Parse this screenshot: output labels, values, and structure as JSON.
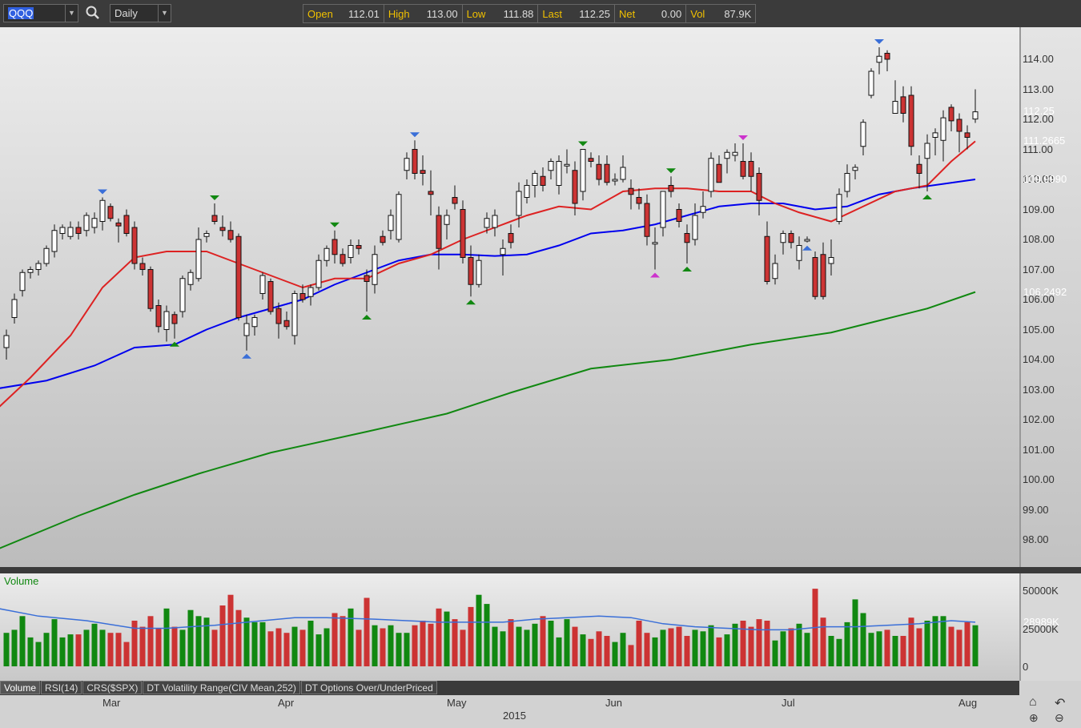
{
  "toolbar": {
    "symbol": "QQQ",
    "period": "Daily",
    "quote": [
      {
        "label": "Open",
        "value": "112.01"
      },
      {
        "label": "High",
        "value": "113.00"
      },
      {
        "label": "Low",
        "value": "111.88"
      },
      {
        "label": "Last",
        "value": "112.25"
      },
      {
        "label": "Net",
        "value": "0.00"
      },
      {
        "label": "Vol",
        "value": "87.9K"
      }
    ]
  },
  "price_axis": {
    "ticks": [
      "114.00",
      "113.00",
      "112.00",
      "111.00",
      "110.00",
      "109.00",
      "108.00",
      "107.00",
      "106.00",
      "105.00",
      "104.00",
      "103.00",
      "102.00",
      "101.00",
      "100.00",
      "99.00",
      "98.00"
    ],
    "badges": [
      {
        "value": "112.25",
        "color": "#444444"
      },
      {
        "value": "111.2665",
        "color": "#cc3333"
      },
      {
        "value": "109.9990",
        "color": "#0000ee"
      },
      {
        "value": "106.2492",
        "color": "#118811"
      }
    ]
  },
  "volume_panel": {
    "title": "Volume",
    "ticks": [
      "50000K",
      "25000K",
      "0"
    ],
    "badge": "28989K",
    "badge_color": "#118811"
  },
  "tabs": [
    "Volume",
    "RSI(14)",
    "CRS($SPX)",
    "DT Volatility Range(CIV Mean,252)",
    "DT Options Over/UnderPriced"
  ],
  "date_axis": {
    "months": [
      "Mar",
      "Apr",
      "May",
      "Jun",
      "Jul",
      "Aug"
    ],
    "year": "2015"
  },
  "nav": {
    "home": "home-icon",
    "undo": "undo-icon",
    "zoom_in": "zoom-in-icon",
    "zoom_out": "zoom-out-icon"
  },
  "colors": {
    "up_volume": "#118811",
    "down_volume": "#cc3333",
    "ma20": "#dd2222",
    "ma50": "#0000ee",
    "ma200": "#118811",
    "vol_ma": "#3a6fd8"
  },
  "chart_data": {
    "type": "candlestick",
    "symbol": "QQQ",
    "ylim": [
      97.5,
      115.5
    ],
    "ohlc": [
      [
        104.4,
        105.0,
        104.0,
        104.8
      ],
      [
        105.4,
        106.2,
        105.2,
        106.0
      ],
      [
        106.3,
        107.0,
        106.1,
        106.9
      ],
      [
        106.9,
        107.1,
        106.7,
        107.0
      ],
      [
        107.0,
        107.3,
        106.8,
        107.2
      ],
      [
        107.2,
        107.8,
        107.1,
        107.7
      ],
      [
        107.6,
        108.5,
        107.4,
        108.3
      ],
      [
        108.2,
        108.5,
        108.0,
        108.4
      ],
      [
        108.1,
        108.6,
        108.0,
        108.4
      ],
      [
        108.4,
        108.6,
        108.0,
        108.2
      ],
      [
        108.3,
        108.9,
        108.1,
        108.8
      ],
      [
        108.4,
        108.9,
        108.2,
        108.7
      ],
      [
        108.6,
        109.4,
        108.3,
        109.3
      ],
      [
        109.1,
        109.2,
        108.6,
        108.7
      ],
      [
        108.55,
        108.7,
        107.9,
        108.45
      ],
      [
        108.8,
        109.0,
        108.1,
        108.2
      ],
      [
        108.4,
        108.6,
        107.0,
        107.2
      ],
      [
        107.2,
        107.4,
        106.8,
        107.0
      ],
      [
        107.0,
        107.1,
        105.6,
        105.7
      ],
      [
        105.8,
        106.0,
        104.9,
        105.1
      ],
      [
        105.0,
        105.8,
        104.6,
        105.6
      ],
      [
        105.5,
        105.6,
        104.7,
        105.2
      ],
      [
        105.6,
        106.8,
        105.4,
        106.7
      ],
      [
        106.5,
        107.0,
        106.3,
        106.9
      ],
      [
        106.7,
        108.4,
        106.6,
        108.0
      ],
      [
        108.1,
        108.3,
        107.9,
        108.2
      ],
      [
        108.8,
        109.2,
        108.5,
        108.6
      ],
      [
        108.4,
        108.8,
        108.1,
        108.3
      ],
      [
        108.3,
        108.6,
        107.9,
        108.0
      ],
      [
        108.1,
        108.2,
        105.3,
        105.4
      ],
      [
        104.8,
        105.5,
        104.3,
        105.2
      ],
      [
        105.1,
        105.5,
        104.8,
        105.4
      ],
      [
        106.2,
        106.9,
        106.0,
        106.8
      ],
      [
        106.6,
        106.7,
        105.5,
        105.6
      ],
      [
        105.7,
        105.9,
        104.7,
        105.2
      ],
      [
        105.3,
        105.6,
        105.0,
        105.1
      ],
      [
        104.8,
        106.3,
        104.5,
        106.2
      ],
      [
        106.2,
        106.5,
        105.9,
        106.0
      ],
      [
        106.1,
        106.5,
        105.8,
        106.4
      ],
      [
        106.4,
        107.5,
        106.3,
        107.3
      ],
      [
        107.3,
        107.8,
        107.1,
        107.7
      ],
      [
        108.0,
        108.3,
        107.2,
        107.5
      ],
      [
        107.5,
        107.7,
        107.1,
        107.2
      ],
      [
        107.4,
        108.0,
        107.2,
        107.8
      ],
      [
        107.8,
        108.0,
        107.5,
        107.7
      ],
      [
        106.8,
        107.0,
        105.6,
        106.6
      ],
      [
        106.5,
        107.8,
        106.2,
        107.5
      ],
      [
        108.1,
        108.3,
        107.8,
        107.9
      ],
      [
        108.3,
        109.0,
        108.0,
        108.8
      ],
      [
        108.0,
        109.6,
        107.9,
        109.5
      ],
      [
        110.3,
        110.9,
        110.0,
        110.7
      ],
      [
        111.0,
        111.3,
        110.0,
        110.2
      ],
      [
        110.3,
        110.8,
        109.8,
        110.2
      ],
      [
        109.6,
        110.3,
        108.8,
        109.5
      ],
      [
        108.8,
        109.1,
        107.0,
        107.7
      ],
      [
        108.5,
        109.0,
        108.0,
        108.8
      ],
      [
        109.4,
        109.8,
        109.0,
        109.2
      ],
      [
        109.0,
        109.3,
        107.2,
        107.4
      ],
      [
        107.4,
        107.8,
        106.1,
        106.5
      ],
      [
        106.5,
        107.5,
        106.4,
        107.3
      ],
      [
        108.4,
        108.9,
        108.2,
        108.7
      ],
      [
        108.4,
        109.0,
        108.1,
        108.8
      ],
      [
        107.5,
        108.0,
        106.8,
        107.7
      ],
      [
        108.2,
        108.5,
        107.7,
        107.9
      ],
      [
        108.8,
        109.9,
        108.4,
        109.6
      ],
      [
        109.4,
        110.0,
        109.2,
        109.8
      ],
      [
        109.8,
        110.3,
        109.4,
        110.2
      ],
      [
        110.1,
        110.4,
        109.6,
        109.8
      ],
      [
        110.3,
        110.7,
        110.0,
        110.6
      ],
      [
        109.8,
        110.8,
        109.5,
        110.6
      ],
      [
        110.5,
        111.0,
        110.2,
        110.5
      ],
      [
        110.3,
        110.6,
        108.8,
        109.2
      ],
      [
        109.6,
        111.0,
        109.3,
        111.0
      ],
      [
        110.7,
        110.9,
        110.4,
        110.6
      ],
      [
        110.5,
        110.8,
        109.8,
        110.0
      ],
      [
        110.5,
        110.8,
        109.8,
        109.9
      ],
      [
        110.0,
        110.2,
        109.8,
        110.0
      ],
      [
        110.0,
        110.8,
        109.9,
        110.4
      ],
      [
        109.7,
        110.0,
        109.0,
        109.5
      ],
      [
        109.4,
        109.7,
        109.0,
        109.2
      ],
      [
        109.2,
        109.5,
        107.8,
        108.1
      ],
      [
        107.9,
        108.4,
        107.0,
        107.9
      ],
      [
        108.4,
        109.6,
        108.1,
        109.6
      ],
      [
        109.8,
        110.1,
        109.4,
        109.6
      ],
      [
        109.0,
        109.2,
        108.4,
        108.6
      ],
      [
        108.2,
        108.5,
        107.2,
        107.9
      ],
      [
        108.0,
        109.2,
        107.8,
        108.8
      ],
      [
        108.9,
        109.6,
        108.7,
        109.1
      ],
      [
        109.6,
        110.9,
        109.4,
        110.7
      ],
      [
        110.5,
        110.8,
        109.9,
        109.9
      ],
      [
        110.7,
        111.0,
        110.2,
        110.9
      ],
      [
        110.8,
        111.2,
        110.6,
        110.9
      ],
      [
        110.6,
        111.2,
        110.0,
        110.1
      ],
      [
        110.6,
        110.9,
        109.6,
        110.1
      ],
      [
        110.2,
        110.4,
        108.8,
        109.3
      ],
      [
        108.1,
        108.6,
        106.5,
        106.6
      ],
      [
        106.7,
        107.5,
        106.5,
        107.2
      ],
      [
        107.9,
        108.3,
        107.5,
        108.2
      ],
      [
        108.2,
        108.3,
        107.7,
        107.9
      ],
      [
        107.3,
        108.1,
        107.0,
        107.8
      ],
      [
        108.0,
        108.1,
        107.9,
        108.0
      ],
      [
        107.4,
        107.6,
        106.0,
        106.1
      ],
      [
        107.5,
        107.9,
        106.0,
        106.1
      ],
      [
        107.2,
        108.0,
        106.8,
        107.4
      ],
      [
        108.6,
        109.7,
        108.5,
        109.5
      ],
      [
        109.6,
        110.5,
        109.4,
        110.2
      ],
      [
        110.3,
        110.5,
        110.0,
        110.4
      ],
      [
        111.1,
        112.0,
        110.8,
        111.9
      ],
      [
        112.8,
        113.7,
        112.7,
        113.6
      ],
      [
        113.9,
        114.4,
        113.5,
        114.1
      ],
      [
        114.2,
        114.3,
        113.6,
        114.0
      ],
      [
        112.2,
        113.3,
        112.2,
        112.6
      ],
      [
        112.75,
        113.1,
        111.9,
        112.2
      ],
      [
        112.8,
        113.1,
        110.8,
        111.1
      ],
      [
        110.5,
        110.8,
        109.7,
        110.2
      ],
      [
        110.7,
        111.5,
        109.6,
        111.2
      ],
      [
        111.4,
        111.7,
        110.8,
        111.55
      ],
      [
        111.3,
        112.3,
        110.6,
        112.05
      ],
      [
        112.4,
        112.5,
        111.6,
        111.95
      ],
      [
        112.0,
        112.2,
        110.9,
        111.6
      ],
      [
        111.55,
        111.8,
        111.0,
        111.4
      ],
      [
        112.01,
        113.0,
        111.88,
        112.25
      ]
    ],
    "ma20": [
      [
        -1,
        102.4
      ],
      [
        3,
        103.4
      ],
      [
        8,
        104.8
      ],
      [
        12,
        106.4
      ],
      [
        16,
        107.4
      ],
      [
        20,
        107.6
      ],
      [
        25,
        107.6
      ],
      [
        29,
        107.2
      ],
      [
        33,
        106.8
      ],
      [
        37,
        106.4
      ],
      [
        41,
        106.7
      ],
      [
        45,
        106.7
      ],
      [
        49,
        107.2
      ],
      [
        53,
        107.5
      ],
      [
        57,
        108.0
      ],
      [
        61,
        108.4
      ],
      [
        65,
        108.8
      ],
      [
        69,
        109.1
      ],
      [
        73,
        109.0
      ],
      [
        77,
        109.6
      ],
      [
        81,
        109.7
      ],
      [
        85,
        109.7
      ],
      [
        89,
        109.6
      ],
      [
        93,
        109.6
      ],
      [
        96,
        109.2
      ],
      [
        99,
        108.9
      ],
      [
        103,
        108.6
      ],
      [
        107,
        109.1
      ],
      [
        111,
        109.6
      ],
      [
        115,
        109.8
      ],
      [
        118,
        110.6
      ],
      [
        121,
        111.27
      ]
    ],
    "ma50": [
      [
        -1,
        103.04
      ],
      [
        5,
        103.3
      ],
      [
        11,
        103.8
      ],
      [
        16,
        104.4
      ],
      [
        21,
        104.5
      ],
      [
        25,
        105.0
      ],
      [
        29,
        105.4
      ],
      [
        33,
        105.7
      ],
      [
        37,
        106.0
      ],
      [
        41,
        106.5
      ],
      [
        45,
        106.9
      ],
      [
        49,
        107.3
      ],
      [
        53,
        107.5
      ],
      [
        57,
        107.5
      ],
      [
        61,
        107.45
      ],
      [
        65,
        107.5
      ],
      [
        69,
        107.8
      ],
      [
        73,
        108.2
      ],
      [
        77,
        108.3
      ],
      [
        81,
        108.5
      ],
      [
        85,
        108.8
      ],
      [
        89,
        109.1
      ],
      [
        93,
        109.2
      ],
      [
        97,
        109.2
      ],
      [
        101,
        109.0
      ],
      [
        105,
        109.1
      ],
      [
        109,
        109.5
      ],
      [
        113,
        109.7
      ],
      [
        117,
        109.85
      ],
      [
        121,
        110.0
      ]
    ],
    "ma200": [
      [
        -1,
        97.7
      ],
      [
        9,
        98.8
      ],
      [
        16,
        99.5
      ],
      [
        24,
        100.2
      ],
      [
        33,
        100.9
      ],
      [
        45,
        101.6
      ],
      [
        55,
        102.2
      ],
      [
        63,
        102.9
      ],
      [
        73,
        103.7
      ],
      [
        83,
        104.0
      ],
      [
        93,
        104.5
      ],
      [
        103,
        104.9
      ],
      [
        109,
        105.3
      ],
      [
        115,
        105.7
      ],
      [
        121,
        106.25
      ]
    ],
    "markers": [
      {
        "i": 12,
        "type": "high",
        "color": "#3a6fd8"
      },
      {
        "i": 21,
        "type": "low",
        "color": "#118811"
      },
      {
        "i": 26,
        "type": "high",
        "color": "#118811"
      },
      {
        "i": 30,
        "type": "low",
        "color": "#3a6fd8"
      },
      {
        "i": 41,
        "type": "high",
        "color": "#118811"
      },
      {
        "i": 45,
        "type": "low",
        "color": "#118811"
      },
      {
        "i": 51,
        "type": "high",
        "color": "#3a6fd8"
      },
      {
        "i": 58,
        "type": "low",
        "color": "#118811"
      },
      {
        "i": 72,
        "type": "high",
        "color": "#118811"
      },
      {
        "i": 81,
        "type": "low",
        "color": "#cc33cc"
      },
      {
        "i": 83,
        "type": "high",
        "color": "#118811"
      },
      {
        "i": 85,
        "type": "low",
        "color": "#118811"
      },
      {
        "i": 92,
        "type": "high",
        "color": "#cc33cc"
      },
      {
        "i": 100,
        "type": "low",
        "color": "#3a6fd8"
      },
      {
        "i": 109,
        "type": "high",
        "color": "#3a6fd8"
      },
      {
        "i": 115,
        "type": "low",
        "color": "#118811"
      }
    ],
    "volume_k": [
      22,
      24,
      33,
      19,
      16,
      22,
      31,
      19,
      21,
      21,
      24,
      28,
      24,
      22,
      22,
      16,
      30,
      26,
      33,
      25,
      38,
      26,
      24,
      37,
      33,
      32,
      24,
      40,
      47,
      37,
      32,
      29,
      29,
      23,
      25,
      22,
      26,
      24,
      30,
      21,
      25,
      35,
      33,
      38,
      24,
      45,
      27,
      25,
      27,
      22,
      22,
      27,
      30,
      28,
      38,
      36,
      31,
      24,
      39,
      47,
      41,
      26,
      23,
      31,
      26,
      24,
      28,
      33,
      30,
      19,
      31,
      26,
      21,
      18,
      23,
      20,
      16,
      22,
      14,
      30,
      22,
      19,
      24,
      25,
      26,
      20,
      24,
      23,
      27,
      19,
      21,
      28,
      30,
      26,
      31,
      30,
      17,
      23,
      25,
      28,
      22,
      51,
      32,
      20,
      18,
      29,
      44,
      35,
      22,
      23,
      24,
      20,
      20,
      32,
      25,
      30,
      33,
      33,
      26,
      24,
      29,
      27,
      24
    ],
    "volume_ma_k": [
      [
        -1,
        38
      ],
      [
        4,
        33
      ],
      [
        10,
        30
      ],
      [
        16,
        25
      ],
      [
        20,
        25
      ],
      [
        26,
        27
      ],
      [
        32,
        30
      ],
      [
        36,
        32
      ],
      [
        40,
        32
      ],
      [
        46,
        31
      ],
      [
        50,
        30
      ],
      [
        54,
        29
      ],
      [
        58,
        29
      ],
      [
        62,
        29
      ],
      [
        66,
        31
      ],
      [
        70,
        32
      ],
      [
        74,
        33
      ],
      [
        78,
        32
      ],
      [
        82,
        28
      ],
      [
        86,
        26
      ],
      [
        90,
        25
      ],
      [
        94,
        24
      ],
      [
        98,
        24
      ],
      [
        102,
        26
      ],
      [
        106,
        26
      ],
      [
        110,
        27
      ],
      [
        114,
        28
      ],
      [
        118,
        30
      ],
      [
        121,
        29
      ]
    ],
    "volume_ylim": [
      0,
      50000
    ]
  }
}
